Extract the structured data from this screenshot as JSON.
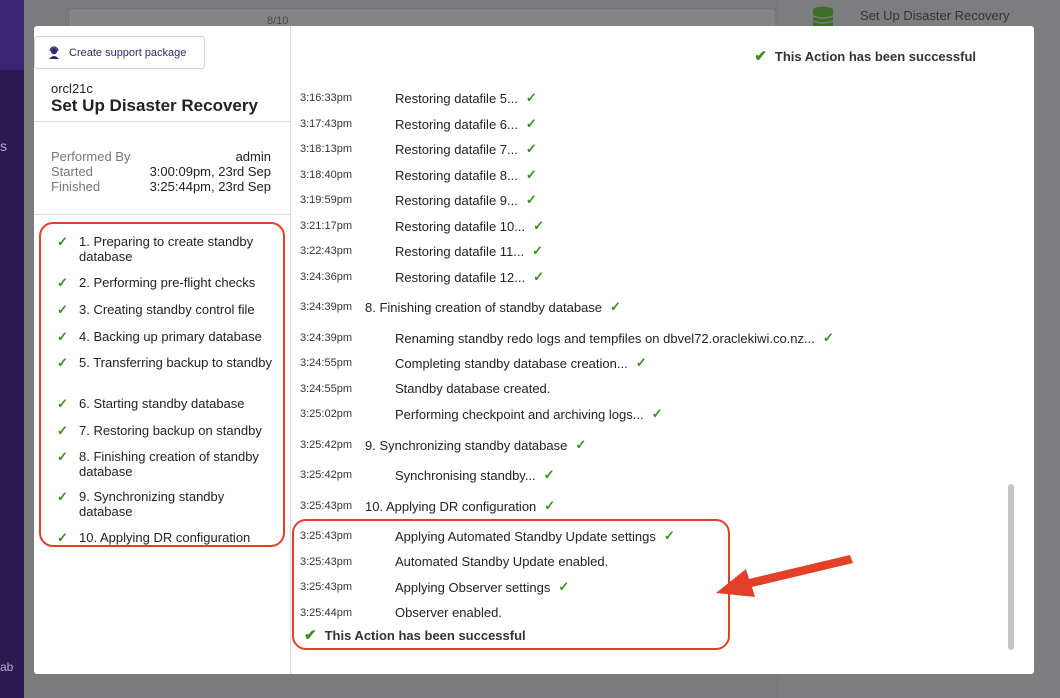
{
  "background": {
    "table_count": "8/10",
    "right_item_label": "Set Up Disaster Recovery",
    "sidebar_letter": "s",
    "sidebar_bottom": "ab"
  },
  "modal": {
    "support_button": "Create support package",
    "db_name": "orcl21c",
    "action_title": "Set Up Disaster Recovery",
    "meta": {
      "performed_by_label": "Performed By",
      "performed_by_value": "admin",
      "started_label": "Started",
      "started_value": "3:00:09pm, 23rd Sep",
      "finished_label": "Finished",
      "finished_value": "3:25:44pm, 23rd Sep"
    },
    "steps": [
      "1. Preparing to create standby database",
      "2. Performing pre-flight checks",
      "3. Creating standby control file",
      "4. Backing up primary database",
      "5. Transferring backup to standby",
      "6. Starting standby database",
      "7. Restoring backup on standby",
      "8. Finishing creation of standby database",
      "9. Synchronizing standby database",
      "10. Applying DR configuration"
    ],
    "success_message": "This Action has been successful",
    "log": [
      {
        "time": "3:16:33pm",
        "msg": "Restoring datafile 5...",
        "ok": true,
        "sub": true
      },
      {
        "time": "3:17:43pm",
        "msg": "Restoring datafile 6...",
        "ok": true,
        "sub": true
      },
      {
        "time": "3:18:13pm",
        "msg": "Restoring datafile 7...",
        "ok": true,
        "sub": true
      },
      {
        "time": "3:18:40pm",
        "msg": "Restoring datafile 8...",
        "ok": true,
        "sub": true
      },
      {
        "time": "3:19:59pm",
        "msg": "Restoring datafile 9...",
        "ok": true,
        "sub": true
      },
      {
        "time": "3:21:17pm",
        "msg": "Restoring datafile 10...",
        "ok": true,
        "sub": true
      },
      {
        "time": "3:22:43pm",
        "msg": "Restoring datafile 11...",
        "ok": true,
        "sub": true
      },
      {
        "time": "3:24:36pm",
        "msg": "Restoring datafile 12...",
        "ok": true,
        "sub": true
      },
      {
        "time": "3:24:39pm",
        "msg": "8. Finishing creation of standby database",
        "ok": true,
        "sub": false
      },
      {
        "time": "3:24:39pm",
        "msg": "Renaming standby redo logs and tempfiles on dbvel72.oraclekiwi.co.nz...",
        "ok": true,
        "sub": true
      },
      {
        "time": "3:24:55pm",
        "msg": "Completing standby database creation...",
        "ok": true,
        "sub": true
      },
      {
        "time": "3:24:55pm",
        "msg": "Standby database created.",
        "ok": false,
        "sub": true
      },
      {
        "time": "3:25:02pm",
        "msg": "Performing checkpoint and archiving logs...",
        "ok": true,
        "sub": true
      },
      {
        "time": "3:25:42pm",
        "msg": "9. Synchronizing standby database",
        "ok": true,
        "sub": false
      },
      {
        "time": "3:25:42pm",
        "msg": "Synchronising standby...",
        "ok": true,
        "sub": true
      },
      {
        "time": "3:25:43pm",
        "msg": "10. Applying DR configuration",
        "ok": true,
        "sub": false
      },
      {
        "time": "3:25:43pm",
        "msg": "Applying Automated Standby Update settings",
        "ok": true,
        "sub": true
      },
      {
        "time": "3:25:43pm",
        "msg": "Automated Standby Update enabled.",
        "ok": false,
        "sub": true
      },
      {
        "time": "3:25:43pm",
        "msg": "Applying Observer settings",
        "ok": true,
        "sub": true
      },
      {
        "time": "3:25:44pm",
        "msg": "Observer enabled.",
        "ok": false,
        "sub": true
      }
    ]
  },
  "colors": {
    "success_green": "#3a8f1f",
    "annotation_red": "#e3402a",
    "sidebar_purple": "#2a1a52"
  }
}
